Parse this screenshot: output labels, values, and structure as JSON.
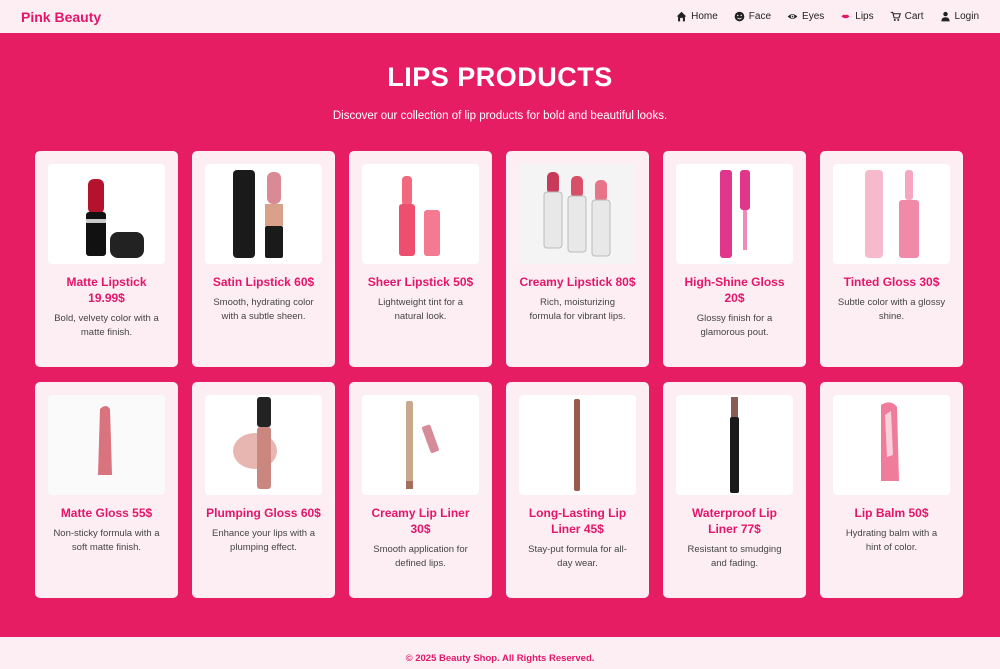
{
  "brand": "Pink Beauty",
  "nav": [
    {
      "label": "Home",
      "icon": "home-icon"
    },
    {
      "label": "Face",
      "icon": "face-icon"
    },
    {
      "label": "Eyes",
      "icon": "eye-icon"
    },
    {
      "label": "Lips",
      "icon": "lips-icon"
    },
    {
      "label": "Cart",
      "icon": "cart-icon"
    },
    {
      "label": "Login",
      "icon": "user-icon"
    }
  ],
  "hero": {
    "title": "LIPS PRODUCTS",
    "subtitle": "Discover our collection of lip products for bold and beautiful looks."
  },
  "products": [
    {
      "title": "Matte Lipstick 19.99$",
      "desc": "Bold, velvety color with a matte finish.",
      "kind": "lipstick-matte"
    },
    {
      "title": "Satin Lipstick 60$",
      "desc": "Smooth, hydrating color with a subtle sheen.",
      "kind": "lipstick-satin"
    },
    {
      "title": "Sheer Lipstick 50$",
      "desc": "Lightweight tint for a natural look.",
      "kind": "lipstick-sheer"
    },
    {
      "title": "Creamy Lipstick 80$",
      "desc": "Rich, moisturizing formula for vibrant lips.",
      "kind": "lipstick-creamy"
    },
    {
      "title": "High-Shine Gloss 20$",
      "desc": "Glossy finish for a glamorous pout.",
      "kind": "gloss-shine"
    },
    {
      "title": "Tinted Gloss 30$",
      "desc": "Subtle color with a glossy shine.",
      "kind": "gloss-tinted"
    },
    {
      "title": "Matte Gloss 55$",
      "desc": "Non-sticky formula with a soft matte finish.",
      "kind": "gloss-matte"
    },
    {
      "title": "Plumping Gloss 60$",
      "desc": "Enhance your lips with a plumping effect.",
      "kind": "gloss-plumping"
    },
    {
      "title": "Creamy Lip Liner 30$",
      "desc": "Smooth application for defined lips.",
      "kind": "liner-creamy"
    },
    {
      "title": "Long-Lasting Lip Liner 45$",
      "desc": "Stay-put formula for all-day wear.",
      "kind": "liner-long"
    },
    {
      "title": "Waterproof Lip Liner 77$",
      "desc": "Resistant to smudging and fading.",
      "kind": "liner-waterproof"
    },
    {
      "title": "Lip Balm 50$",
      "desc": "Hydrating balm with a hint of color.",
      "kind": "balm"
    }
  ],
  "footer": "© 2025 Beauty Shop. All Rights Reserved.",
  "colors": {
    "accent": "#e71d63",
    "brand_text": "#e3166a",
    "card_bg": "#fdeef4"
  }
}
